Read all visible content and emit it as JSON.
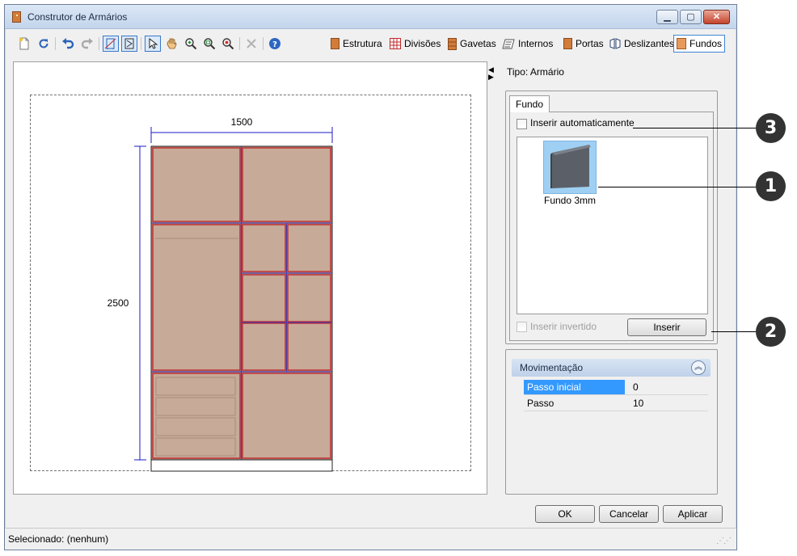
{
  "window": {
    "title": "Construtor de Armários",
    "controls": {
      "minimize_icon": "minimize-icon",
      "maximize_icon": "maximize-icon",
      "close_icon": "close-icon"
    }
  },
  "toolbar": {
    "icons": [
      "new-icon",
      "refresh-icon",
      "undo-icon",
      "redo-icon",
      "front-view-icon",
      "side-view-icon",
      "select-icon",
      "pan-icon",
      "zoom-in-icon",
      "zoom-window-icon",
      "zoom-icon",
      "delete-icon",
      "help-icon"
    ],
    "tabs": [
      {
        "label": "Estrutura",
        "icon": "structure-icon"
      },
      {
        "label": "Divisões",
        "icon": "grid-icon"
      },
      {
        "label": "Gavetas",
        "icon": "drawers-icon"
      },
      {
        "label": "Internos",
        "icon": "internals-icon"
      },
      {
        "label": "Portas",
        "icon": "door-icon"
      },
      {
        "label": "Deslizantes",
        "icon": "sliding-door-icon"
      },
      {
        "label": "Fundos",
        "icon": "back-panel-icon",
        "active": true
      }
    ]
  },
  "drawing": {
    "width_dimension": "1500",
    "height_dimension": "2500"
  },
  "panel": {
    "tipo": "Tipo: Armário",
    "fundo_tab": "Fundo",
    "auto_insert_label": "Inserir automaticamente",
    "auto_insert_checked": false,
    "items": [
      {
        "label": "Fundo 3mm",
        "icon": "back-panel-thumbnail"
      }
    ],
    "inverted_label": "Inserir invertido",
    "inverted_enabled": false,
    "insert_button": "Inserir"
  },
  "movement": {
    "title": "Movimentação",
    "collapse_icon": "chevron-up-icon",
    "properties": [
      {
        "name": "Passo inicial",
        "value": "0",
        "selected": true
      },
      {
        "name": "Passo",
        "value": "10",
        "selected": false
      }
    ]
  },
  "buttons": {
    "ok": "OK",
    "cancel": "Cancelar",
    "apply": "Aplicar"
  },
  "status": {
    "text": "Selecionado: (nenhum)"
  },
  "callouts": [
    "3",
    "1",
    "2"
  ],
  "colors": {
    "panel_fill": "#c8aa98",
    "panel_edge": "#c0282b",
    "dimension_line": "#1a1ac8",
    "callout": "#333333",
    "accent": "#3399ff"
  }
}
